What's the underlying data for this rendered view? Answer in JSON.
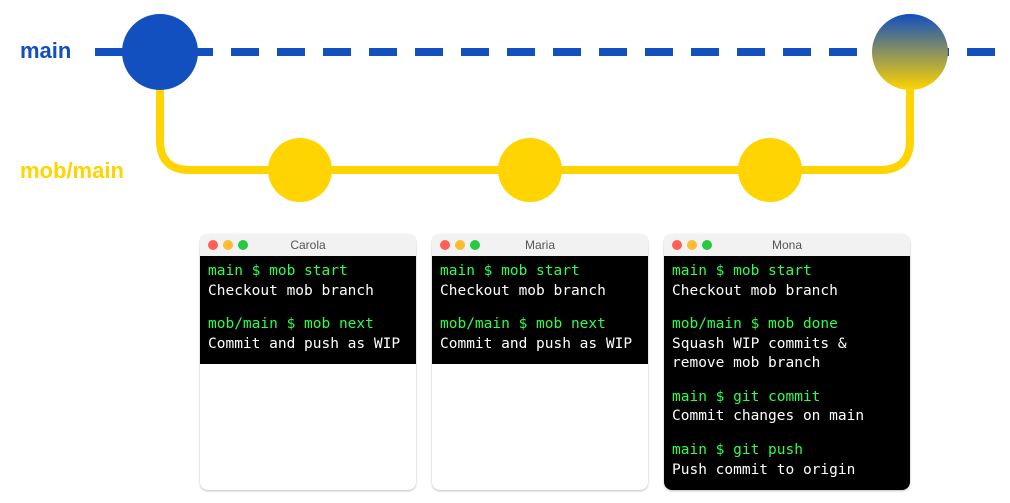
{
  "branches": {
    "main_label": "main",
    "mob_label": "mob/main"
  },
  "colors": {
    "main": "#124fbf",
    "mob": "#ffd400",
    "terminal_bg": "#000000",
    "cmd_green": "#2bff4a"
  },
  "terminals": [
    {
      "user": "Carola",
      "blocks": [
        {
          "cmd": "main $ mob start",
          "desc": "Checkout mob branch"
        },
        {
          "cmd": "mob/main $ mob next",
          "desc": "Commit and push as WIP"
        }
      ]
    },
    {
      "user": "Maria",
      "blocks": [
        {
          "cmd": "main $ mob start",
          "desc": "Checkout mob branch"
        },
        {
          "cmd": "mob/main $ mob next",
          "desc": "Commit and push as WIP"
        }
      ]
    },
    {
      "user": "Mona",
      "blocks": [
        {
          "cmd": "main $ mob start",
          "desc": "Checkout mob branch"
        },
        {
          "cmd": "mob/main $ mob done",
          "desc": "Squash WIP commits & remove mob branch"
        },
        {
          "cmd": "main $ git commit",
          "desc": "Commit changes on main"
        },
        {
          "cmd": "main $ git push",
          "desc": "Push commit to origin"
        }
      ]
    }
  ]
}
